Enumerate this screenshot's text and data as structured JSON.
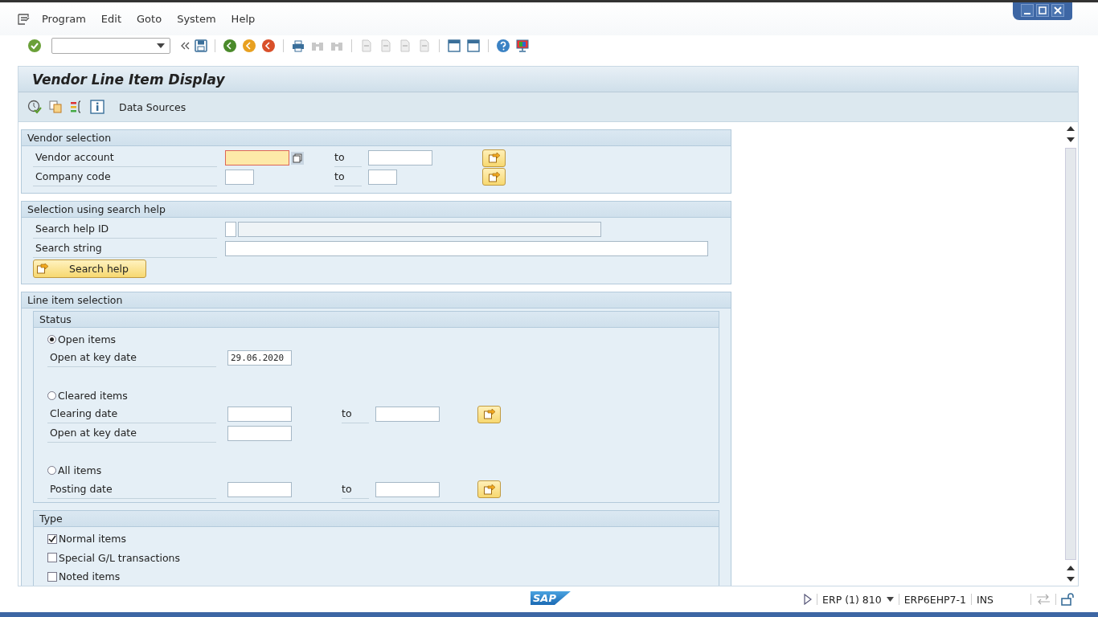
{
  "menu": [
    "Program",
    "Edit",
    "Goto",
    "System",
    "Help"
  ],
  "title": "Vendor Line Item Display",
  "app_toolbar": {
    "label": "Data Sources"
  },
  "sections": [
    {
      "title": "Vendor selection",
      "rows": [
        {
          "kind": "range",
          "label": "Vendor account",
          "to": "to",
          "focused": true
        },
        {
          "kind": "short_range",
          "label": "Company code",
          "to": "to",
          "focused": false
        }
      ]
    },
    {
      "title": "Selection using search help",
      "rows": [
        {
          "kind": "searchid",
          "label": "Search help ID"
        },
        {
          "kind": "wide",
          "label": "Search string"
        },
        {
          "kind": "button",
          "label": "Search help"
        }
      ]
    },
    {
      "title": "Line item selection",
      "groups": [
        {
          "title": "Status",
          "rows": [
            {
              "kind": "radio",
              "label": "Open items",
              "selected": true
            },
            {
              "kind": "single",
              "label": "Open at key date",
              "value": "29.06.2020"
            },
            {
              "kind": "spacer"
            },
            {
              "kind": "radio",
              "label": "Cleared items",
              "selected": false
            },
            {
              "kind": "range",
              "label": "Clearing date",
              "to": "to"
            },
            {
              "kind": "single",
              "label": "Open at key date"
            },
            {
              "kind": "spacer"
            },
            {
              "kind": "radio",
              "label": "All items",
              "selected": false
            },
            {
              "kind": "range",
              "label": "Posting date",
              "to": "to"
            }
          ]
        },
        {
          "title": "Type",
          "rows": [
            {
              "kind": "check",
              "label": "Normal items",
              "checked": true
            },
            {
              "kind": "check",
              "label": "Special G/L transactions",
              "checked": false
            },
            {
              "kind": "check",
              "label": "Noted items",
              "checked": false
            }
          ]
        }
      ]
    }
  ],
  "status_bar": {
    "logo": "SAP",
    "items": [
      "ERP (1) 810",
      "ERP6EHP7-1",
      "INS"
    ]
  }
}
